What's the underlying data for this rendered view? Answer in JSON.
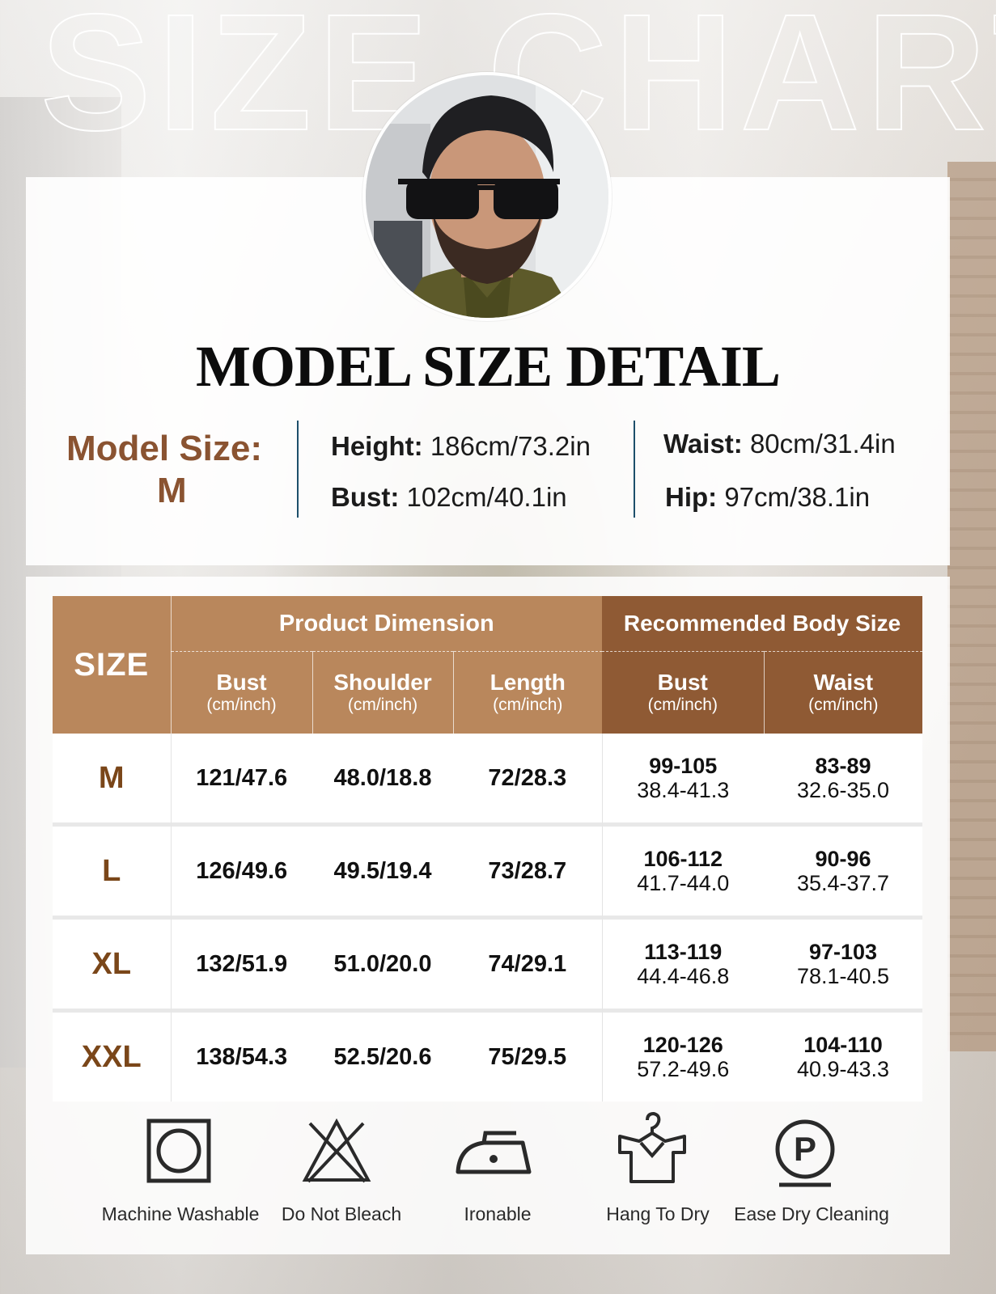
{
  "background_title": "SIZE CHART",
  "heading": "MODEL SIZE DETAIL",
  "model": {
    "size_label": "Model Size:",
    "size_value": "M",
    "height_label": "Height:",
    "height_value": "186cm/73.2in",
    "bust_label": "Bust:",
    "bust_value": "102cm/40.1in",
    "waist_label": "Waist:",
    "waist_value": "80cm/31.4in",
    "hip_label": "Hip:",
    "hip_value": "97cm/38.1in"
  },
  "table": {
    "size_header": "SIZE",
    "product_group": "Product Dimension",
    "recommended_group": "Recommended Body Size",
    "unit": "(cm/inch)",
    "columns": {
      "bust": "Bust",
      "shoulder": "Shoulder",
      "length": "Length",
      "body_bust": "Bust",
      "body_waist": "Waist"
    },
    "rows": [
      {
        "size": "M",
        "bust": "121/47.6",
        "shoulder": "48.0/18.8",
        "length": "72/28.3",
        "body_bust_cm": "99-105",
        "body_bust_in": "38.4-41.3",
        "body_waist_cm": "83-89",
        "body_waist_in": "32.6-35.0"
      },
      {
        "size": "L",
        "bust": "126/49.6",
        "shoulder": "49.5/19.4",
        "length": "73/28.7",
        "body_bust_cm": "106-112",
        "body_bust_in": "41.7-44.0",
        "body_waist_cm": "90-96",
        "body_waist_in": "35.4-37.7"
      },
      {
        "size": "XL",
        "bust": "132/51.9",
        "shoulder": "51.0/20.0",
        "length": "74/29.1",
        "body_bust_cm": "113-119",
        "body_bust_in": "44.4-46.8",
        "body_waist_cm": "97-103",
        "body_waist_in": "78.1-40.5"
      },
      {
        "size": "XXL",
        "bust": "138/54.3",
        "shoulder": "52.5/20.6",
        "length": "75/29.5",
        "body_bust_cm": "120-126",
        "body_bust_in": "57.2-49.6",
        "body_waist_cm": "104-110",
        "body_waist_in": "40.9-43.3"
      }
    ]
  },
  "care": [
    {
      "icon": "machine-wash-icon",
      "label": "Machine Washable"
    },
    {
      "icon": "no-bleach-icon",
      "label": "Do Not Bleach"
    },
    {
      "icon": "iron-icon",
      "label": "Ironable"
    },
    {
      "icon": "hang-dry-icon",
      "label": "Hang To Dry"
    },
    {
      "icon": "dry-clean-icon",
      "label": "Ease Dry Cleaning",
      "glyph": "P"
    }
  ],
  "colors": {
    "accent_brown": "#8a5331",
    "header_light": "#b9875c",
    "header_dark": "#8f5a34",
    "divider_blue": "#1d4f6b"
  }
}
